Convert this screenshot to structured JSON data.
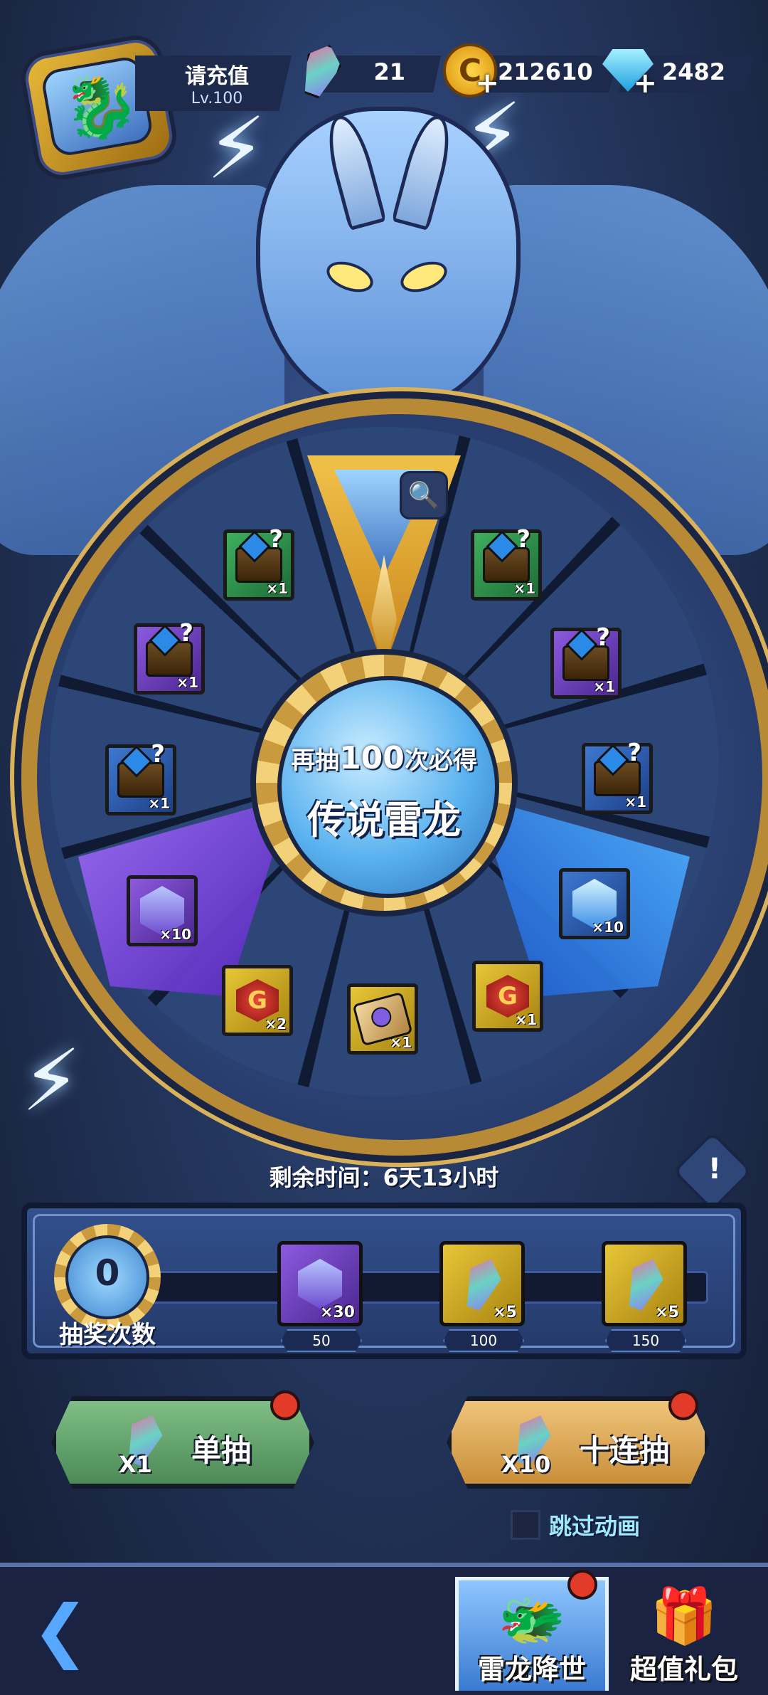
{
  "player": {
    "name": "请充值",
    "level": "Lv.100"
  },
  "resources": [
    {
      "name": "crystal",
      "value": "21"
    },
    {
      "name": "gold",
      "value": "212610"
    },
    {
      "name": "diamond",
      "value": "2482"
    }
  ],
  "wheel": {
    "center_line1_prefix": "再抽",
    "center_line1_number": "100",
    "center_line1_suffix": "次必得",
    "center_line2": "传说雷龙",
    "items": [
      {
        "id": "chest-green-1",
        "qty": "×1"
      },
      {
        "id": "chest-green-2",
        "qty": "×1"
      },
      {
        "id": "chest-purple-1",
        "qty": "×1"
      },
      {
        "id": "chest-purple-2",
        "qty": "×1"
      },
      {
        "id": "chest-blue-1",
        "qty": "×1"
      },
      {
        "id": "chest-blue-2",
        "qty": "×1"
      },
      {
        "id": "purple-gem",
        "qty": "×10"
      },
      {
        "id": "blue-gem",
        "qty": "×10"
      },
      {
        "id": "red-sigil-1",
        "qty": "×2"
      },
      {
        "id": "scroll",
        "qty": "×1"
      },
      {
        "id": "red-sigil-2",
        "qty": "×1"
      }
    ]
  },
  "timer": "剩余时间：6天13小时",
  "progress": {
    "count": "0",
    "label": "抽奖次数",
    "milestones": [
      {
        "qty": "×30",
        "threshold": "50"
      },
      {
        "qty": "×5",
        "threshold": "100"
      },
      {
        "qty": "×5",
        "threshold": "150"
      }
    ]
  },
  "buttons": {
    "single": {
      "label": "单抽",
      "cost": "X1"
    },
    "ten": {
      "label": "十连抽",
      "cost": "X10"
    }
  },
  "skip_animation": "跳过动画",
  "tabs": [
    {
      "label": "雷龙降世"
    },
    {
      "label": "超值礼包"
    }
  ]
}
